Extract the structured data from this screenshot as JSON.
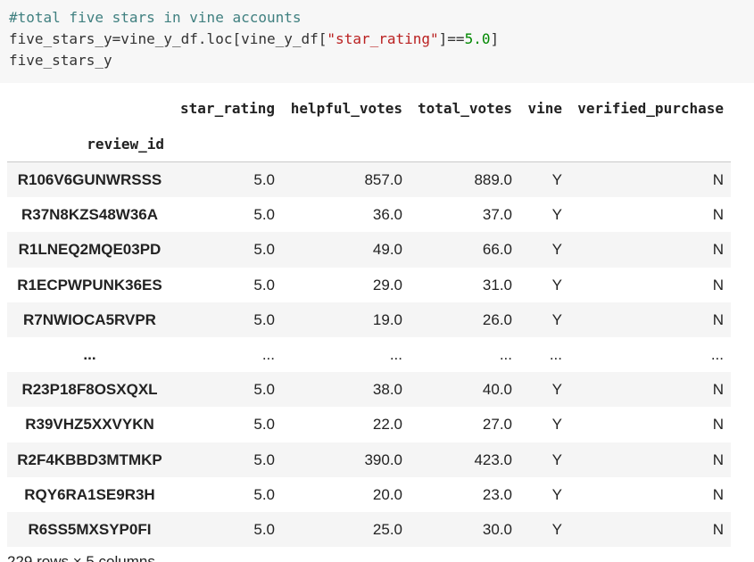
{
  "code": {
    "comment": "#total five stars in vine accounts",
    "line2": {
      "part1": "five_stars_y=vine_y_df.loc[vine_y_df[",
      "string": "\"star_rating\"",
      "part2": "]==",
      "number": "5.0",
      "part3": "]"
    },
    "line3": "five_stars_y"
  },
  "dataframe": {
    "index_name": "review_id",
    "columns": [
      "star_rating",
      "helpful_votes",
      "total_votes",
      "vine",
      "verified_purchase"
    ],
    "rows": [
      {
        "id": "R106V6GUNWRSSS",
        "star_rating": "5.0",
        "helpful_votes": "857.0",
        "total_votes": "889.0",
        "vine": "Y",
        "verified_purchase": "N"
      },
      {
        "id": "R37N8KZS48W36A",
        "star_rating": "5.0",
        "helpful_votes": "36.0",
        "total_votes": "37.0",
        "vine": "Y",
        "verified_purchase": "N"
      },
      {
        "id": "R1LNEQ2MQE03PD",
        "star_rating": "5.0",
        "helpful_votes": "49.0",
        "total_votes": "66.0",
        "vine": "Y",
        "verified_purchase": "N"
      },
      {
        "id": "R1ECPWPUNK36ES",
        "star_rating": "5.0",
        "helpful_votes": "29.0",
        "total_votes": "31.0",
        "vine": "Y",
        "verified_purchase": "N"
      },
      {
        "id": "R7NWIOCA5RVPR",
        "star_rating": "5.0",
        "helpful_votes": "19.0",
        "total_votes": "26.0",
        "vine": "Y",
        "verified_purchase": "N"
      },
      {
        "id": "...",
        "star_rating": "...",
        "helpful_votes": "...",
        "total_votes": "...",
        "vine": "...",
        "verified_purchase": "..."
      },
      {
        "id": "R23P18F8OSXQXL",
        "star_rating": "5.0",
        "helpful_votes": "38.0",
        "total_votes": "40.0",
        "vine": "Y",
        "verified_purchase": "N"
      },
      {
        "id": "R39VHZ5XXVYKN",
        "star_rating": "5.0",
        "helpful_votes": "22.0",
        "total_votes": "27.0",
        "vine": "Y",
        "verified_purchase": "N"
      },
      {
        "id": "R2F4KBBD3MTMKP",
        "star_rating": "5.0",
        "helpful_votes": "390.0",
        "total_votes": "423.0",
        "vine": "Y",
        "verified_purchase": "N"
      },
      {
        "id": "RQY6RA1SE9R3H",
        "star_rating": "5.0",
        "helpful_votes": "20.0",
        "total_votes": "23.0",
        "vine": "Y",
        "verified_purchase": "N"
      },
      {
        "id": "R6SS5MXSYP0FI",
        "star_rating": "5.0",
        "helpful_votes": "25.0",
        "total_votes": "30.0",
        "vine": "Y",
        "verified_purchase": "N"
      }
    ],
    "summary": "229 rows × 5 columns"
  }
}
